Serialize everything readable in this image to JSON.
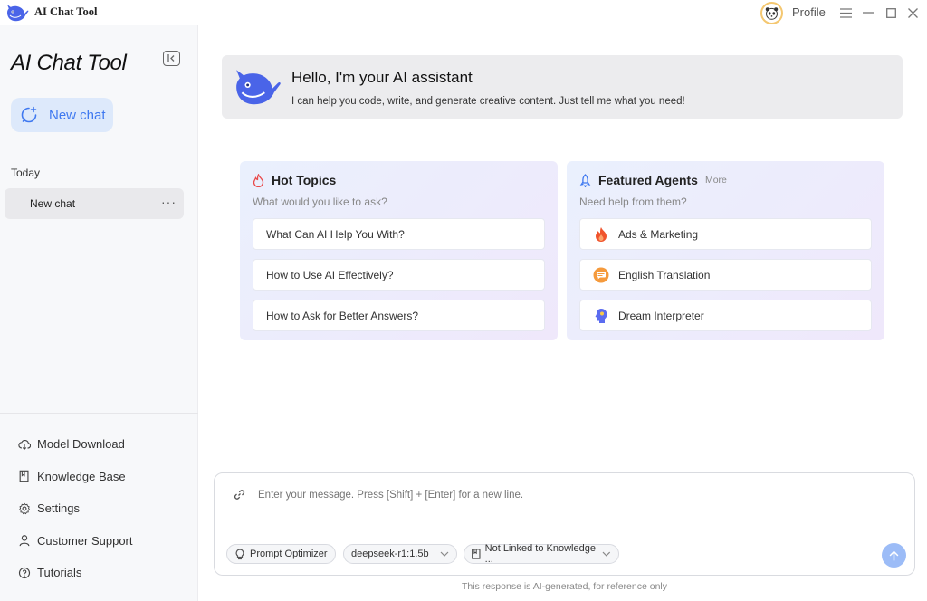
{
  "titlebar": {
    "app_title": "AI Chat Tool",
    "profile_label": "Profile"
  },
  "sidebar": {
    "brand": "AI Chat Tool",
    "new_chat_label": "New chat",
    "section_today": "Today",
    "chat_items": [
      {
        "label": "New chat",
        "more": "···"
      }
    ],
    "nav": [
      {
        "label": "Model Download",
        "icon": "cloud-download-icon"
      },
      {
        "label": "Knowledge Base",
        "icon": "book-icon"
      },
      {
        "label": "Settings",
        "icon": "gear-icon"
      },
      {
        "label": "Customer Support",
        "icon": "user-icon"
      },
      {
        "label": "Tutorials",
        "icon": "help-circle-icon"
      }
    ]
  },
  "hero": {
    "title": "Hello, I'm your AI assistant",
    "subtitle": "I can help you code, write, and generate creative content. Just tell me what you need!"
  },
  "hot_topics": {
    "title": "Hot Topics",
    "subtitle": "What would you like to ask?",
    "items": [
      "What Can AI Help You With?",
      "How to Use AI Effectively?",
      "How to Ask for Better Answers?"
    ]
  },
  "featured_agents": {
    "title": "Featured Agents",
    "more": "More",
    "subtitle": "Need help from them?",
    "items": [
      {
        "label": "Ads & Marketing",
        "icon": "flame-icon",
        "color": "#f0542d"
      },
      {
        "label": "English Translation",
        "icon": "chat-bubble-icon",
        "color": "#f59a3c"
      },
      {
        "label": "Dream Interpreter",
        "icon": "head-icon",
        "color": "#5b6cf0"
      }
    ]
  },
  "composer": {
    "placeholder": "Enter your message. Press [Shift] + [Enter] for a new line.",
    "prompt_optimizer": "Prompt Optimizer",
    "model": "deepseek-r1:1.5b",
    "knowledge": "Not Linked to Knowledge ..."
  },
  "disclaimer": "This response is AI-generated, for reference only",
  "colors": {
    "accent": "#3e78f0",
    "new_chat_bg": "#dde9fb",
    "send_button": "#9cbcf7"
  }
}
